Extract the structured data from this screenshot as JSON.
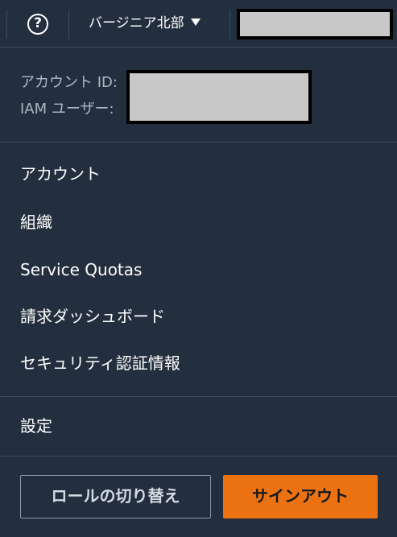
{
  "header": {
    "help_symbol": "?",
    "region_label": "バージニア北部"
  },
  "account_info": {
    "account_id_label": "アカウント ID:",
    "iam_user_label": "IAM ユーザー:"
  },
  "menu": {
    "items": [
      {
        "label": "アカウント"
      },
      {
        "label": "組織"
      },
      {
        "label": "Service Quotas"
      },
      {
        "label": "請求ダッシュボード"
      },
      {
        "label": "セキュリティ認証情報"
      }
    ],
    "settings_label": "設定"
  },
  "actions": {
    "switch_role_label": "ロールの切り替え",
    "sign_out_label": "サインアウト"
  },
  "colors": {
    "background": "#232f3e",
    "accent": "#ec7211",
    "redaction": "#c8c8c8"
  }
}
